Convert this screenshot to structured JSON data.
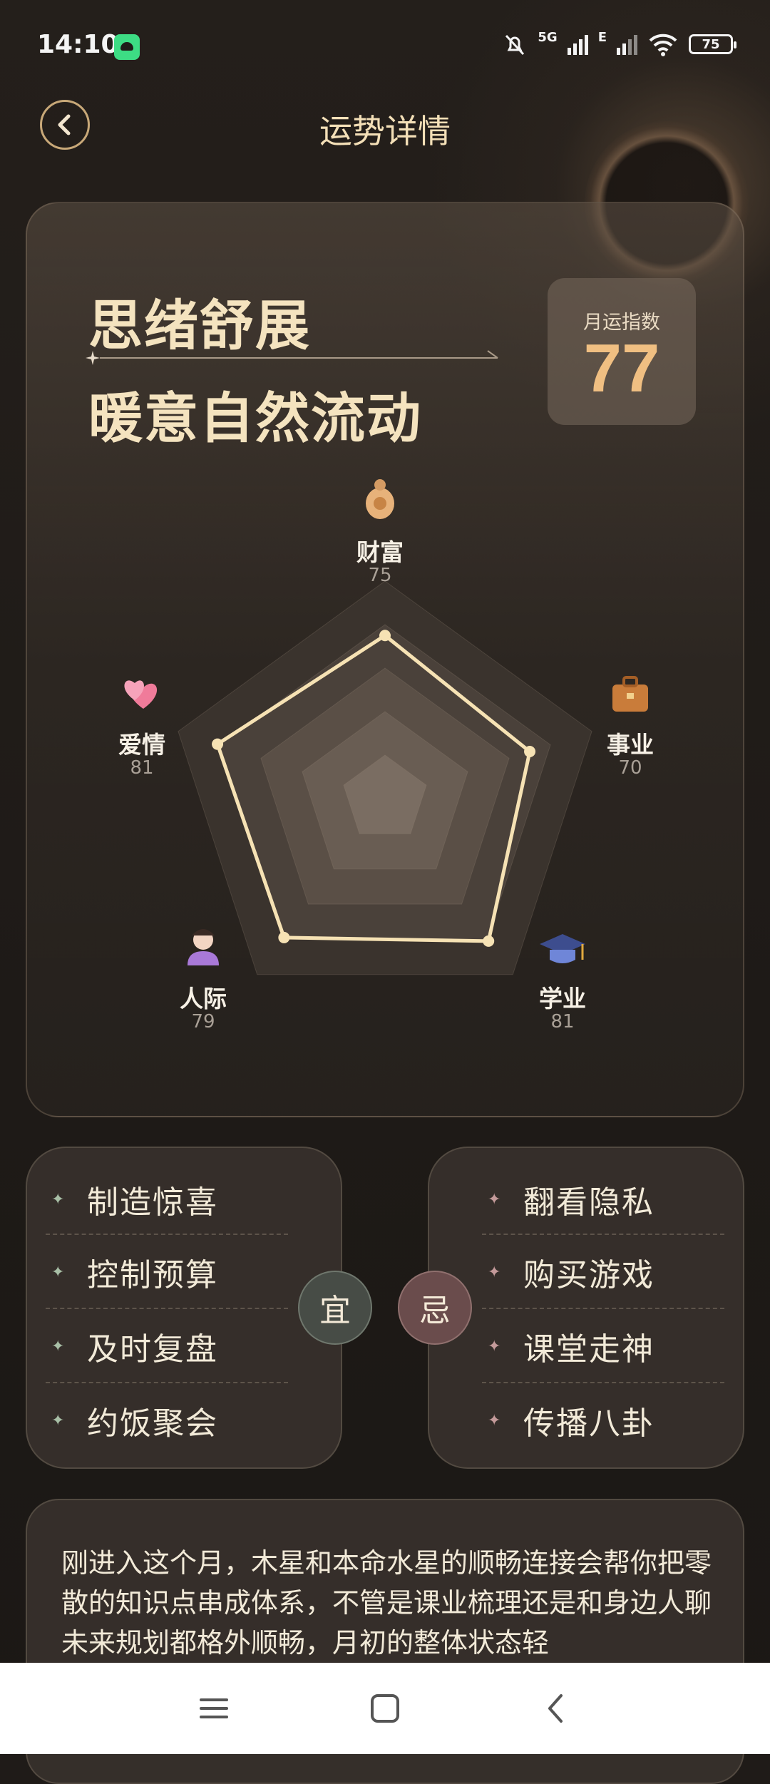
{
  "status_bar": {
    "time": "14:10",
    "network_5g": "5G",
    "network_e": "E",
    "battery": "75"
  },
  "header": {
    "title": "运势详情",
    "back_icon": "chevron-left-icon"
  },
  "summary": {
    "headline_line1": "思绪舒展",
    "headline_line2": "暖意自然流动",
    "index_label": "月运指数",
    "index_value": "77"
  },
  "chart_data": {
    "type": "radar",
    "scale_max": 100,
    "axes": [
      {
        "label": "财富",
        "value": 75,
        "icon": "money-bag-icon"
      },
      {
        "label": "事业",
        "value": 70,
        "icon": "briefcase-icon"
      },
      {
        "label": "学业",
        "value": 81,
        "icon": "graduation-cap-icon"
      },
      {
        "label": "人际",
        "value": 79,
        "icon": "person-icon"
      },
      {
        "label": "爱情",
        "value": 81,
        "icon": "two-hearts-icon"
      }
    ]
  },
  "yi": {
    "badge": "宜",
    "items": [
      "制造惊喜",
      "控制预算",
      "及时复盘",
      "约饭聚会"
    ]
  },
  "ji": {
    "badge": "忌",
    "items": [
      "翻看隐私",
      "购买游戏",
      "课堂走神",
      "传播八卦"
    ]
  },
  "description": {
    "text": "刚进入这个月，木星和本命水星的顺畅连接会帮你把零散的知识点串成体系，不管是课业梳理还是和身边人聊未来规划都格外顺畅，月初的整体状态轻"
  },
  "colors": {
    "accent_gold": "#f0bf82",
    "radar_line": "#f6e2b4",
    "yi_badge": "#474c46",
    "ji_badge": "#6a4c4c"
  }
}
